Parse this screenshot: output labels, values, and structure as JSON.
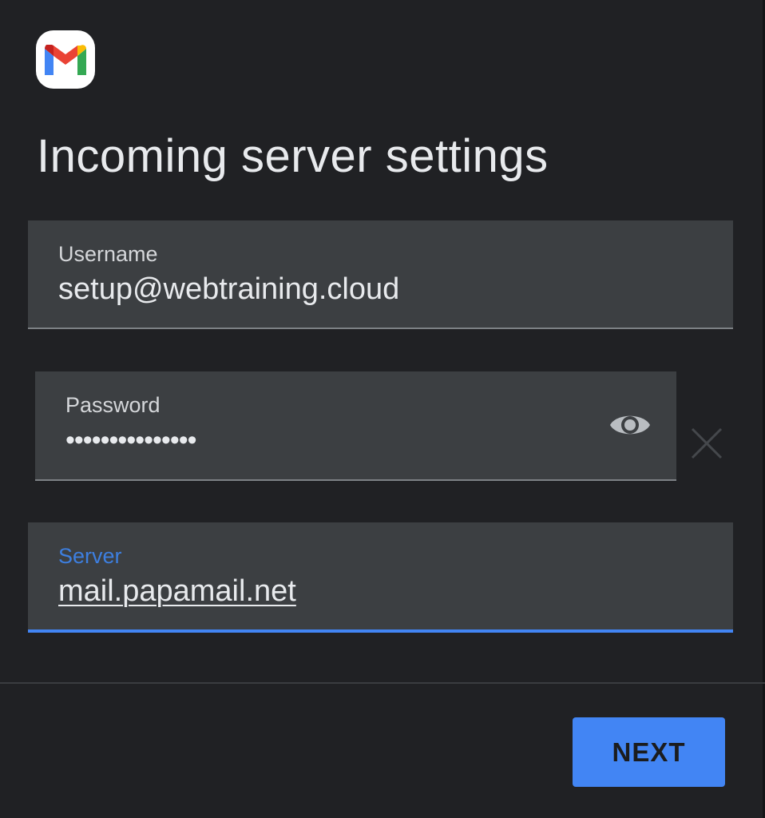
{
  "app": {
    "logo_icon": "gmail-logo",
    "logo_colors": [
      "#ea4335",
      "#4285f4",
      "#34a853",
      "#fbbc04",
      "#c5221f"
    ]
  },
  "page": {
    "title": "Incoming server settings"
  },
  "form": {
    "username": {
      "label": "Username",
      "value": "setup@webtraining.cloud"
    },
    "password": {
      "label": "Password",
      "value": "•••••••••••••••",
      "toggle_icon": "eye-icon",
      "clear_icon": "close-icon"
    },
    "server": {
      "label": "Server",
      "value": "mail.papamail.net",
      "focused": true
    }
  },
  "footer": {
    "next_label": "NEXT"
  },
  "colors": {
    "background": "#202124",
    "field_background": "#3c3f42",
    "accent": "#4285f4",
    "focused_label": "#3d7fe0"
  }
}
